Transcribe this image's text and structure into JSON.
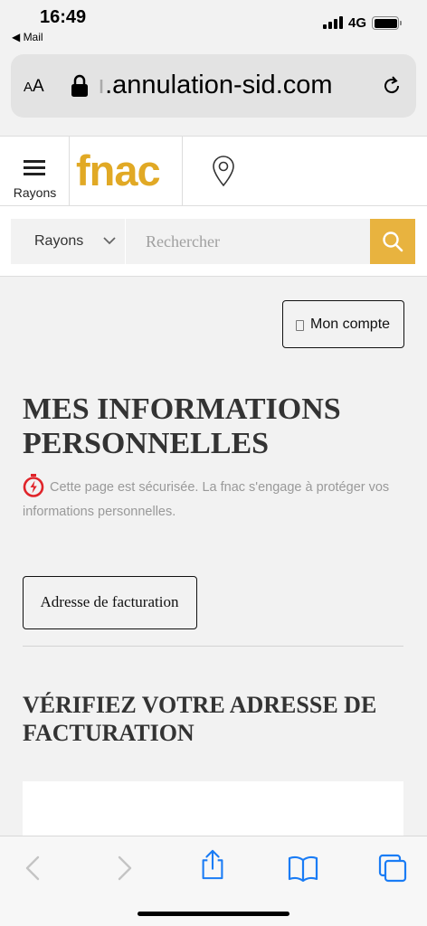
{
  "status_bar": {
    "time": "16:49",
    "back_label": "◀ Mail",
    "network": "4G"
  },
  "browser": {
    "text_size_label": "A",
    "text_size_label_large": "A",
    "url_faded": "ı",
    "url": ".annulation-sid.com"
  },
  "header": {
    "menu_label": "Rayons",
    "logo_text": "fnac"
  },
  "search": {
    "category_label": "Rayons",
    "placeholder": "Rechercher"
  },
  "main": {
    "account_button": "Mon compte",
    "title": "MES INFORMATIONS PERSONNELLES",
    "secure_text": "Cette page est sécurisée. La fnac s'engage à protéger vos informations personnelles.",
    "billing_button": "Adresse de facturation",
    "subtitle": "VÉRIFIEZ VOTRE ADRESSE DE FACTURATION"
  },
  "colors": {
    "brand": "#e1a925",
    "search_button": "#e8b33f",
    "secure_icon": "#e0242a",
    "ios_blue": "#1a7cf5"
  },
  "icons": [
    "lock-icon",
    "reload-icon",
    "hamburger-icon",
    "location-pin-icon",
    "chevron-down-icon",
    "search-icon",
    "secure-stopwatch-icon",
    "back-arrow-icon",
    "forward-arrow-icon",
    "share-icon",
    "bookmarks-icon",
    "tabs-icon"
  ]
}
